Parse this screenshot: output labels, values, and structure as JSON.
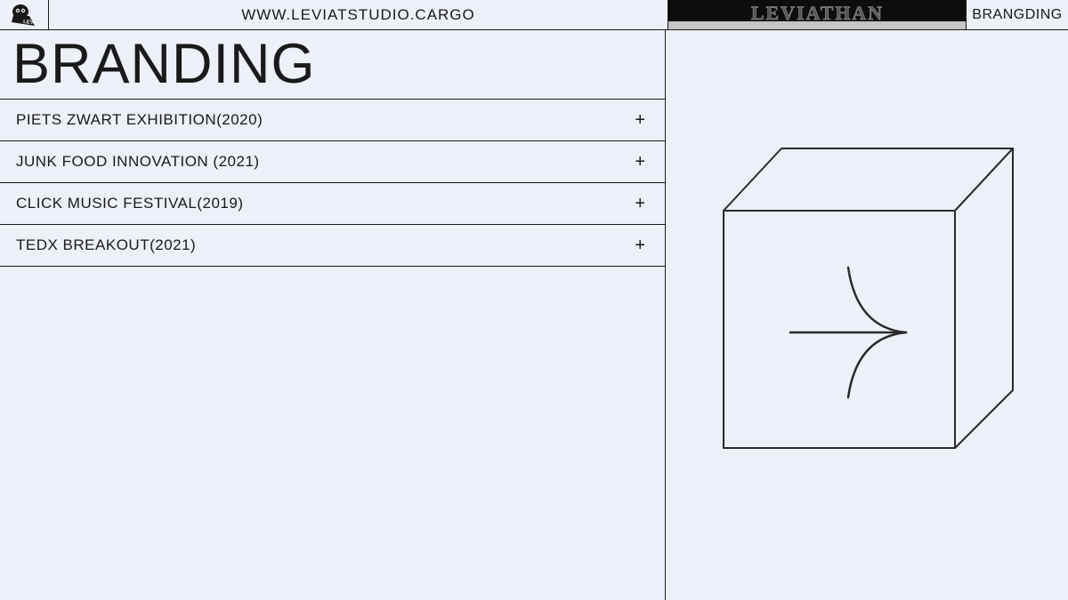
{
  "header": {
    "url": "WWW.LEVIATSTUDIO.CARGO",
    "section_label": "BRANGDING"
  },
  "page": {
    "title": "BRANDING"
  },
  "projects": [
    {
      "label": "PIETS ZWART EXHIBITION(2020)"
    },
    {
      "label": "JUNK FOOD INNOVATION (2021)"
    },
    {
      "label": "CLICK MUSIC FESTIVAL(2019)"
    },
    {
      "label": "TEDX BREAKOUT(2021)"
    }
  ]
}
